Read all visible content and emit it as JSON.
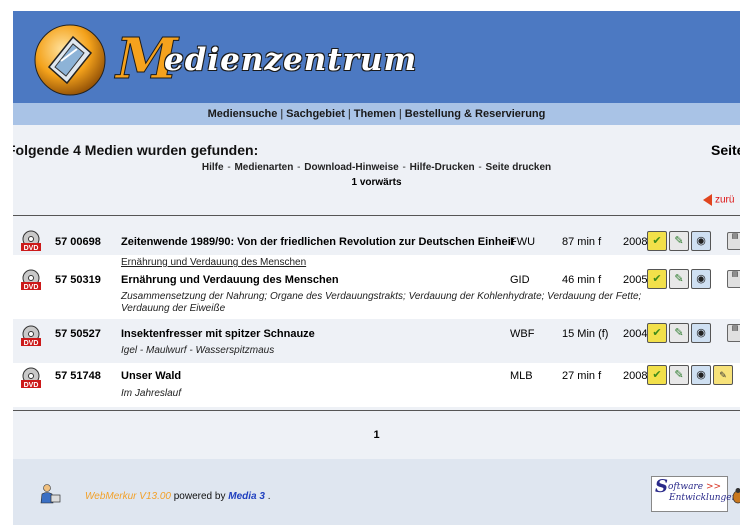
{
  "banner": {
    "brand_initial": "M",
    "brand_rest": "edienzentrum"
  },
  "nav": {
    "items": [
      "Mediensuche",
      "Sachgebiet",
      "Themen",
      "Bestellung & Reservierung"
    ],
    "separator": "|"
  },
  "results": {
    "heading": "Folgende 4 Medien wurden gefunden:",
    "page_label": "Seite",
    "help_links": [
      "Hilfe",
      "Medienarten",
      "Download-Hinweise",
      "Hilfe-Drucken",
      "Seite drucken"
    ],
    "help_separator": "-",
    "forward": "1 vorwärts",
    "back": "zurü"
  },
  "icons": {
    "media_type": "dvd-icon",
    "row_actions": [
      "check-doc-icon",
      "edit-doc-icon",
      "eye-icon"
    ],
    "extra": "pdf-icon"
  },
  "rows": [
    {
      "id": "57 00698",
      "title": "Zeitenwende 1989/90: Von der friedlichen Revolution zur Deutschen Einheit",
      "series": "",
      "description": "",
      "producer": "FWU",
      "length": "87 min f",
      "year": "2008"
    },
    {
      "id": "57 50319",
      "title": "Ernährung und Verdauung des Menschen",
      "series": "Ernährung und Verdauung des Menschen",
      "description": "Zusammensetzung der Nahrung; Organe des Verdauungstrakts; Verdauung der Kohlenhydrate; Verdauung der Fette; Verdauung der Eiweiße",
      "producer": "GID",
      "length": "46 min f",
      "year": "2005"
    },
    {
      "id": "57 50527",
      "title": "Insektenfresser mit spitzer Schnauze",
      "series": "",
      "description": "Igel - Maulwurf - Wasserspitzmaus",
      "producer": "WBF",
      "length": "15 Min (f)",
      "year": "2004"
    },
    {
      "id": "57 51748",
      "title": "Unser Wald",
      "series": "",
      "description": "Im Jahreslauf",
      "producer": "MLB",
      "length": "27 min f",
      "year": "2008"
    }
  ],
  "pager": {
    "current": "1"
  },
  "footer": {
    "webmerkur": "WebMerkur V13.00",
    "powered_by": " powered by ",
    "media3": "Media 3",
    "period": " .",
    "sw_logo_initial": "S",
    "sw_logo_line1": "oftware",
    "sw_logo_arrows": ">>",
    "sw_logo_line2": "Entwicklungen"
  },
  "colors": {
    "banner": "#4c79c2",
    "navbar": "#a9c3e6",
    "page": "#eef1f6",
    "brand_orange": "#f6a21d",
    "link_red": "#d11111"
  }
}
